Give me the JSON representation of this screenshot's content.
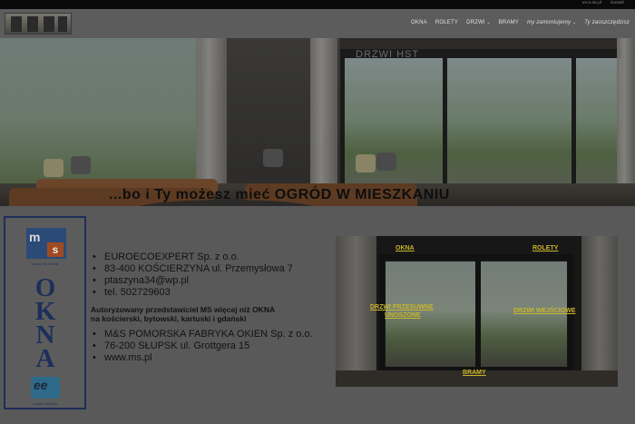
{
  "topbar": {
    "link_1": "www.ms.pl",
    "link_2": "kontakt"
  },
  "nav": {
    "items": [
      "OKNA",
      "ROLETY",
      "DRZWI",
      "BRAMY",
      "my zamontujemy",
      "Ty zaoszczędzisz"
    ]
  },
  "hero": {
    "sign": "DRZWI HST",
    "tagline": "...bo i Ty możesz mieć OGRÓD W MIESZKANIU"
  },
  "badge": {
    "logo_letters_1": "m",
    "logo_letters_2": "s",
    "logo_caption": "więcej niż OKNA",
    "title": "OKNA",
    "bottom_logo": "ee",
    "bottom_caption": "i super mondes"
  },
  "contact": {
    "lines": [
      "EUROECOEXPERT Sp. z o.o.",
      "83-400 KOŚCIERZYNA ul. Przemysłowa 7",
      "ptaszyna34@wp.pl",
      "tel. 502729603"
    ],
    "authorized_1": "Autoryzowany przedstawiciel MS więcej niż OKNA",
    "authorized_2": "na kościerski, bytowski, kartuski i gdański",
    "manufacturer": [
      "M&S POMORSKA FABRYKA OKIEN Sp. z o.o.",
      "76-200 SŁUPSK ul. Grottgera 15",
      "www.ms.pl"
    ]
  },
  "tile": {
    "labels": {
      "okna": "OKNA",
      "rolety": "ROLETY",
      "drzwi_przesuwne": "DRZWI PRZESUWNE",
      "drzwi_przesuwne_2": "UNOSZONE",
      "drzwi_wejsciowe": "DRZWI WEJŚCIOWE",
      "bramy": "BRAMY"
    }
  }
}
